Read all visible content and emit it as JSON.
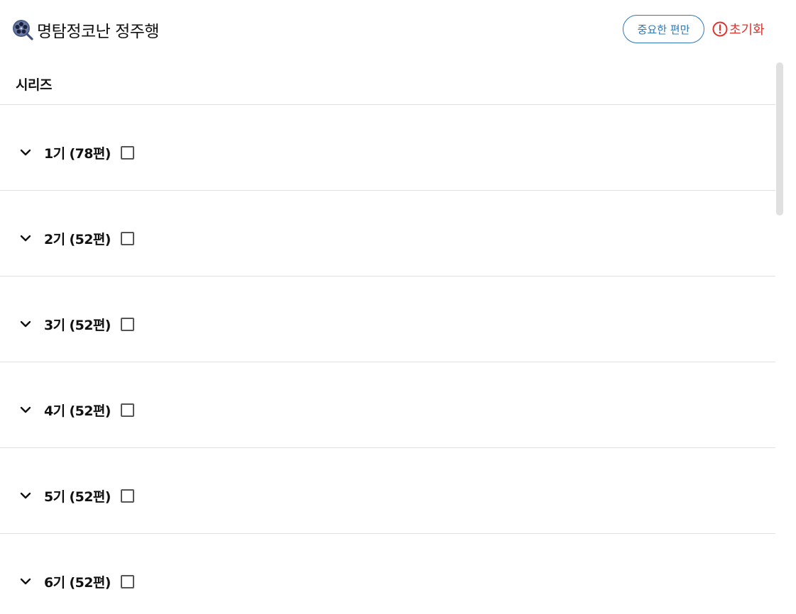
{
  "app": {
    "title": "명탐정코난 정주행",
    "logo_icon": "film-reel-magnifier-icon"
  },
  "header": {
    "important_only_label": "중요한 편만",
    "reset_label": "초기화",
    "reset_icon": "alert-circle-icon",
    "accent_color": "#2f78b8",
    "reset_color": "#e2302a"
  },
  "series": {
    "section_label": "시리즈",
    "seasons": [
      {
        "label": "1기 (78편)",
        "checked": false,
        "expanded": false
      },
      {
        "label": "2기 (52편)",
        "checked": false,
        "expanded": false
      },
      {
        "label": "3기 (52편)",
        "checked": false,
        "expanded": false
      },
      {
        "label": "4기 (52편)",
        "checked": false,
        "expanded": false
      },
      {
        "label": "5기 (52편)",
        "checked": false,
        "expanded": false
      },
      {
        "label": "6기 (52편)",
        "checked": false,
        "expanded": false
      }
    ]
  }
}
